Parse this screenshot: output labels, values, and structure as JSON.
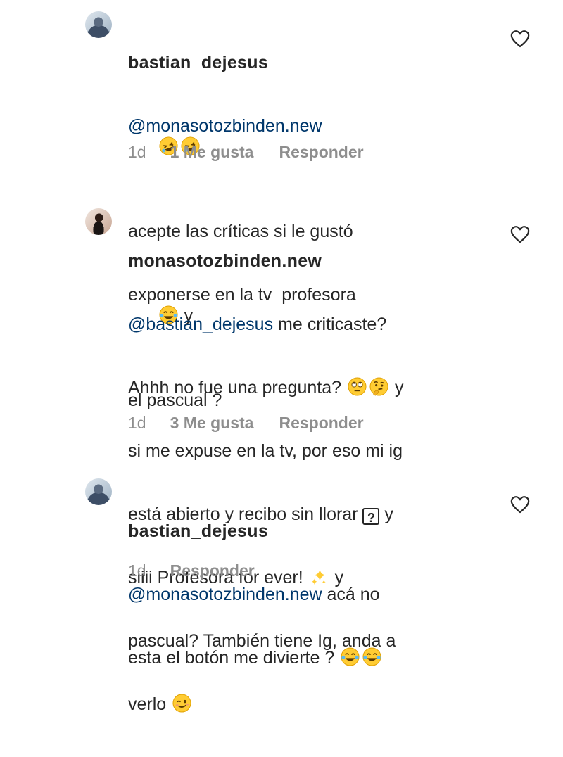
{
  "comments": [
    {
      "username": "bastian_dejesus",
      "mention": "@monasotozbinden.new",
      "line2": "acepte las críticas si le gustó",
      "line3a": "exponerse en la tv  profesora",
      "line3b": " y",
      "line4": "el pascual ?",
      "time": "1d",
      "likes": "1 Me gusta",
      "reply": "Responder"
    },
    {
      "username": "monasotozbinden.new",
      "mention": "@bastian_dejesus",
      "line1_rest": " me criticaste?",
      "line2a": "Ahhh no fue una pregunta? ",
      "line2b": " y",
      "line3": "si me expuse en la tv, por eso mi ig",
      "line4a": "está abierto y recibo sin llorar ",
      "line4b": " y",
      "line5a": "siiii Profesora for ever! ",
      "line5b": " y",
      "line6": "pascual? También tiene Ig, anda a",
      "line7": "verlo ",
      "time": "1d",
      "likes": "3 Me gusta",
      "reply": "Responder"
    },
    {
      "username": "bastian_dejesus",
      "mention": "@monasotozbinden.new",
      "line1_rest": " acá no",
      "line2": "esta el botón me divierte ? ",
      "time": "1d",
      "reply": "Responder"
    }
  ],
  "colors": {
    "text": "#262626",
    "mention": "#00376b",
    "meta": "#8e8e8e"
  },
  "icons": {
    "heart": "heart-outline-icon",
    "rofl": "rolling-on-floor-laughing-emoji",
    "joy": "face-with-tears-of-joy-emoji",
    "eyeroll": "face-with-rolling-eyes-emoji",
    "thinking": "thinking-face-emoji",
    "sparkles": "sparkles-emoji",
    "wink": "winking-face-emoji",
    "question_box": "question-mark-box-icon"
  }
}
